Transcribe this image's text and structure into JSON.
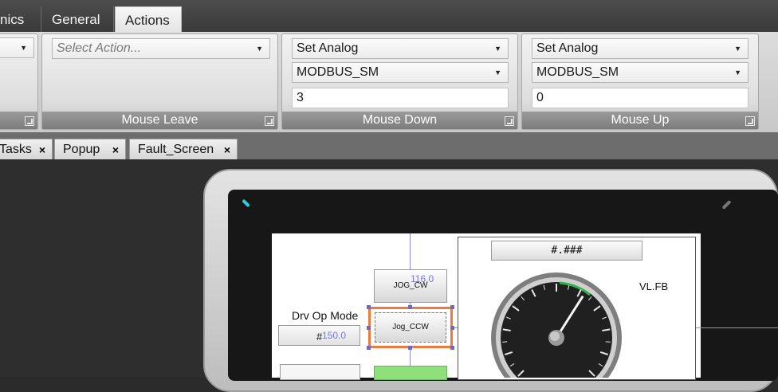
{
  "top_tabs": {
    "items": [
      {
        "label": "nics"
      },
      {
        "label": "General"
      },
      {
        "label": "Actions"
      }
    ],
    "active": "Actions"
  },
  "ribbon": {
    "groups": {
      "partial_left": {
        "combo_value": ""
      },
      "mouse_leave": {
        "title": "Mouse Leave",
        "action_placeholder": "Select Action..."
      },
      "mouse_down": {
        "title": "Mouse Down",
        "action": "Set Analog",
        "target": "MODBUS_SM",
        "value": "3"
      },
      "mouse_up": {
        "title": "Mouse Up",
        "action": "Set Analog",
        "target": "MODBUS_SM",
        "value": "0"
      }
    }
  },
  "doc_tabs": {
    "items": [
      {
        "label": "Tasks"
      },
      {
        "label": "Popup"
      },
      {
        "label": "Fault_Screen"
      }
    ],
    "close_glyph": "×"
  },
  "screen_design": {
    "numeric_display": "#.###",
    "speed_label": "VL.FB",
    "drv_op_mode_label": "Drv Op Mode",
    "drv_op_mode_value": "#",
    "jog_cw_label": "JOG_CW",
    "jog_ccw_label": "Jog_CCW",
    "dim_width": "116.0",
    "dim_height": "150.0",
    "gauge_needle_fraction": 0.62
  },
  "colors": {
    "accent_led": "#27d0d8",
    "selection_outline": "#f07a3c",
    "guide_line": "#8c8cd8",
    "green_indicator": "#8ee07a"
  }
}
